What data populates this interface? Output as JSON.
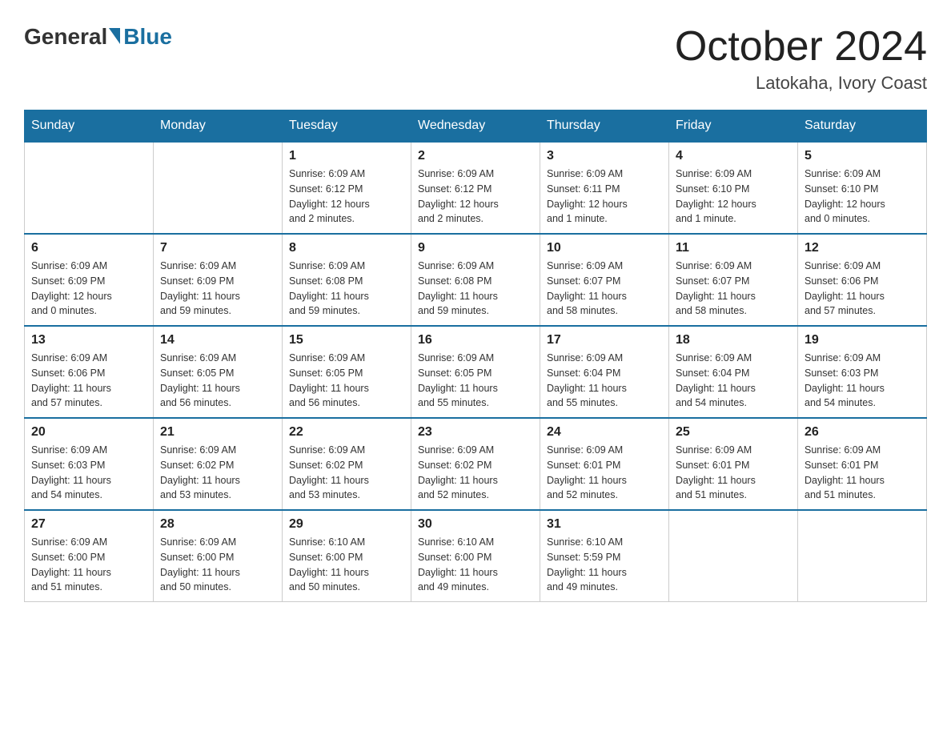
{
  "header": {
    "logo": {
      "general": "General",
      "blue": "Blue"
    },
    "title": "October 2024",
    "location": "Latokaha, Ivory Coast"
  },
  "calendar": {
    "days_of_week": [
      "Sunday",
      "Monday",
      "Tuesday",
      "Wednesday",
      "Thursday",
      "Friday",
      "Saturday"
    ],
    "weeks": [
      [
        {
          "day": "",
          "info": ""
        },
        {
          "day": "",
          "info": ""
        },
        {
          "day": "1",
          "info": "Sunrise: 6:09 AM\nSunset: 6:12 PM\nDaylight: 12 hours\nand 2 minutes."
        },
        {
          "day": "2",
          "info": "Sunrise: 6:09 AM\nSunset: 6:12 PM\nDaylight: 12 hours\nand 2 minutes."
        },
        {
          "day": "3",
          "info": "Sunrise: 6:09 AM\nSunset: 6:11 PM\nDaylight: 12 hours\nand 1 minute."
        },
        {
          "day": "4",
          "info": "Sunrise: 6:09 AM\nSunset: 6:10 PM\nDaylight: 12 hours\nand 1 minute."
        },
        {
          "day": "5",
          "info": "Sunrise: 6:09 AM\nSunset: 6:10 PM\nDaylight: 12 hours\nand 0 minutes."
        }
      ],
      [
        {
          "day": "6",
          "info": "Sunrise: 6:09 AM\nSunset: 6:09 PM\nDaylight: 12 hours\nand 0 minutes."
        },
        {
          "day": "7",
          "info": "Sunrise: 6:09 AM\nSunset: 6:09 PM\nDaylight: 11 hours\nand 59 minutes."
        },
        {
          "day": "8",
          "info": "Sunrise: 6:09 AM\nSunset: 6:08 PM\nDaylight: 11 hours\nand 59 minutes."
        },
        {
          "day": "9",
          "info": "Sunrise: 6:09 AM\nSunset: 6:08 PM\nDaylight: 11 hours\nand 59 minutes."
        },
        {
          "day": "10",
          "info": "Sunrise: 6:09 AM\nSunset: 6:07 PM\nDaylight: 11 hours\nand 58 minutes."
        },
        {
          "day": "11",
          "info": "Sunrise: 6:09 AM\nSunset: 6:07 PM\nDaylight: 11 hours\nand 58 minutes."
        },
        {
          "day": "12",
          "info": "Sunrise: 6:09 AM\nSunset: 6:06 PM\nDaylight: 11 hours\nand 57 minutes."
        }
      ],
      [
        {
          "day": "13",
          "info": "Sunrise: 6:09 AM\nSunset: 6:06 PM\nDaylight: 11 hours\nand 57 minutes."
        },
        {
          "day": "14",
          "info": "Sunrise: 6:09 AM\nSunset: 6:05 PM\nDaylight: 11 hours\nand 56 minutes."
        },
        {
          "day": "15",
          "info": "Sunrise: 6:09 AM\nSunset: 6:05 PM\nDaylight: 11 hours\nand 56 minutes."
        },
        {
          "day": "16",
          "info": "Sunrise: 6:09 AM\nSunset: 6:05 PM\nDaylight: 11 hours\nand 55 minutes."
        },
        {
          "day": "17",
          "info": "Sunrise: 6:09 AM\nSunset: 6:04 PM\nDaylight: 11 hours\nand 55 minutes."
        },
        {
          "day": "18",
          "info": "Sunrise: 6:09 AM\nSunset: 6:04 PM\nDaylight: 11 hours\nand 54 minutes."
        },
        {
          "day": "19",
          "info": "Sunrise: 6:09 AM\nSunset: 6:03 PM\nDaylight: 11 hours\nand 54 minutes."
        }
      ],
      [
        {
          "day": "20",
          "info": "Sunrise: 6:09 AM\nSunset: 6:03 PM\nDaylight: 11 hours\nand 54 minutes."
        },
        {
          "day": "21",
          "info": "Sunrise: 6:09 AM\nSunset: 6:02 PM\nDaylight: 11 hours\nand 53 minutes."
        },
        {
          "day": "22",
          "info": "Sunrise: 6:09 AM\nSunset: 6:02 PM\nDaylight: 11 hours\nand 53 minutes."
        },
        {
          "day": "23",
          "info": "Sunrise: 6:09 AM\nSunset: 6:02 PM\nDaylight: 11 hours\nand 52 minutes."
        },
        {
          "day": "24",
          "info": "Sunrise: 6:09 AM\nSunset: 6:01 PM\nDaylight: 11 hours\nand 52 minutes."
        },
        {
          "day": "25",
          "info": "Sunrise: 6:09 AM\nSunset: 6:01 PM\nDaylight: 11 hours\nand 51 minutes."
        },
        {
          "day": "26",
          "info": "Sunrise: 6:09 AM\nSunset: 6:01 PM\nDaylight: 11 hours\nand 51 minutes."
        }
      ],
      [
        {
          "day": "27",
          "info": "Sunrise: 6:09 AM\nSunset: 6:00 PM\nDaylight: 11 hours\nand 51 minutes."
        },
        {
          "day": "28",
          "info": "Sunrise: 6:09 AM\nSunset: 6:00 PM\nDaylight: 11 hours\nand 50 minutes."
        },
        {
          "day": "29",
          "info": "Sunrise: 6:10 AM\nSunset: 6:00 PM\nDaylight: 11 hours\nand 50 minutes."
        },
        {
          "day": "30",
          "info": "Sunrise: 6:10 AM\nSunset: 6:00 PM\nDaylight: 11 hours\nand 49 minutes."
        },
        {
          "day": "31",
          "info": "Sunrise: 6:10 AM\nSunset: 5:59 PM\nDaylight: 11 hours\nand 49 minutes."
        },
        {
          "day": "",
          "info": ""
        },
        {
          "day": "",
          "info": ""
        }
      ]
    ]
  }
}
